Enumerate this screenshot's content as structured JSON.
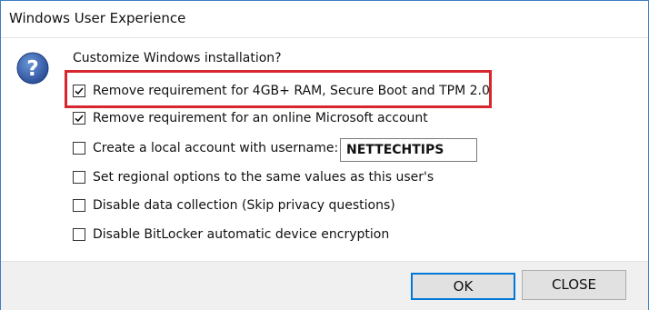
{
  "window": {
    "title": "Windows User Experience"
  },
  "dialog": {
    "icon": "question-icon",
    "prompt": "Customize Windows installation?",
    "options": [
      {
        "label": "Remove requirement for 4GB+ RAM, Secure Boot and TPM 2.0",
        "checked": true
      },
      {
        "label": "Remove requirement for an online Microsoft account",
        "checked": true
      },
      {
        "label": "Create a local account with username:",
        "checked": false
      },
      {
        "label": "Set regional options to the same values as this user's",
        "checked": false
      },
      {
        "label": "Disable data collection (Skip privacy questions)",
        "checked": false
      },
      {
        "label": "Disable BitLocker automatic device encryption",
        "checked": false
      }
    ],
    "username_value": "NETTECHTIPS"
  },
  "buttons": {
    "ok": "OK",
    "close": "CLOSE"
  },
  "colors": {
    "highlight": "#d7262e",
    "accent": "#0078d7",
    "icon": "#2b579a"
  }
}
